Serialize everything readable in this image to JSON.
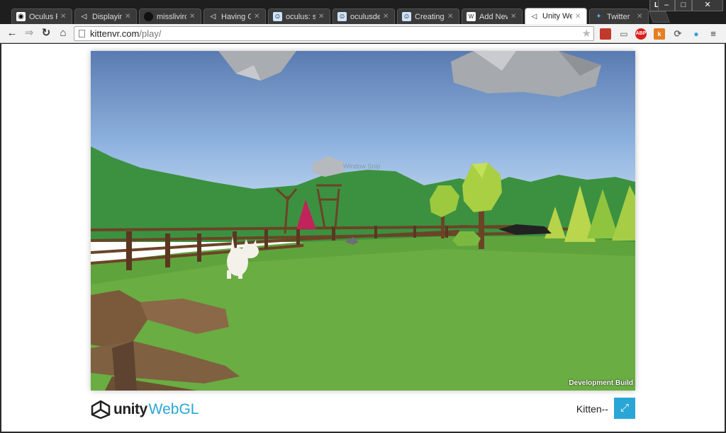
{
  "browser": {
    "profile": "Liv",
    "tabs": [
      {
        "label": "Oculus Rift",
        "icon": "oculus-icon"
      },
      {
        "label": "Displaying",
        "icon": "unity-icon"
      },
      {
        "label": "misslivirose",
        "icon": "github-icon"
      },
      {
        "label": "Having GU",
        "icon": "unity-icon"
      },
      {
        "label": "oculus: sea",
        "icon": "reddit-icon"
      },
      {
        "label": "oculusdev",
        "icon": "reddit-icon"
      },
      {
        "label": "Creating fle",
        "icon": "reddit-icon"
      },
      {
        "label": "Add New P",
        "icon": "wordpress-icon"
      },
      {
        "label": "Unity Web",
        "icon": "unity-icon",
        "active": true
      },
      {
        "label": "Twitter",
        "icon": "twitter-icon"
      }
    ],
    "url_domain": "kittenvr.com",
    "url_path": "/play/",
    "extensions": [
      {
        "name": "bookmark-red-icon",
        "color": "#c0392b"
      },
      {
        "name": "cast-icon",
        "color": "#555555"
      },
      {
        "name": "adblock-icon",
        "label": "ABP",
        "color": "#d9201d"
      },
      {
        "name": "k-extension-icon",
        "label": "k",
        "color": "#e67e22"
      },
      {
        "name": "sync-icon",
        "color": "#666666"
      },
      {
        "name": "dots-extension-icon",
        "color": "#2aa6d6"
      },
      {
        "name": "menu-icon",
        "color": "#333333"
      }
    ]
  },
  "game": {
    "dev_build_label": "Development Build",
    "window_snap_hint": "Window Snip"
  },
  "footer": {
    "logo_unity": "unity",
    "logo_webgl": "WebGL",
    "game_title": "Kitten--",
    "accent_color": "#2aa6d6"
  }
}
